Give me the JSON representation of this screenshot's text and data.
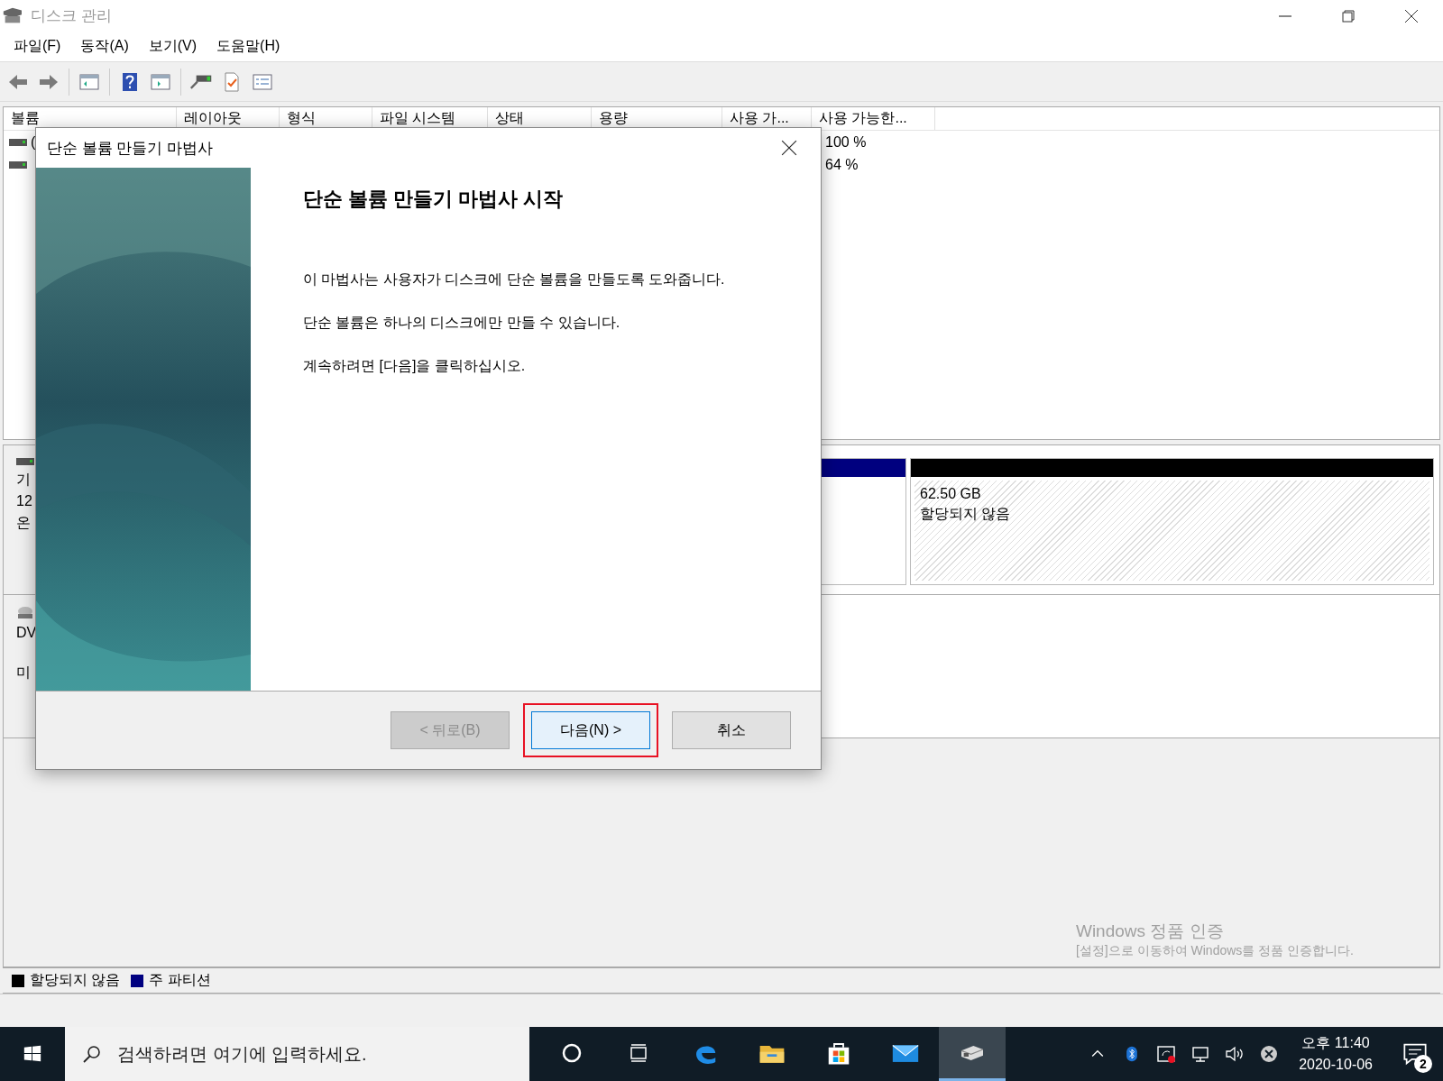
{
  "window": {
    "title": "디스크 관리"
  },
  "menu": [
    "파일(F)",
    "동작(A)",
    "보기(V)",
    "도움말(H)"
  ],
  "toolbar": [
    {
      "kind": "back"
    },
    {
      "kind": "forward"
    },
    {
      "kind": "sep"
    },
    {
      "kind": "pane"
    },
    {
      "kind": "sep"
    },
    {
      "kind": "help"
    },
    {
      "kind": "pane2"
    },
    {
      "kind": "sep"
    },
    {
      "kind": "connect"
    },
    {
      "kind": "check"
    },
    {
      "kind": "props"
    }
  ],
  "volume_table": {
    "columns": [
      "볼륨",
      "레이아웃",
      "형식",
      "파일 시스템",
      "상태",
      "용량",
      "사용 가...",
      "사용 가능한..."
    ],
    "rows": [
      {
        "volume": "(",
        "column_8": "100 %"
      },
      {
        "column_8": "64 %"
      }
    ]
  },
  "disks": [
    {
      "kind": "disk",
      "labels": [
        "기",
        "12",
        "온"
      ],
      "partitions": [
        {
          "kind": "primary",
          "color": "#00007f"
        },
        {
          "kind": "unallocated",
          "color": "#000000",
          "size": "62.50 GB",
          "status": "할당되지 않음"
        }
      ]
    },
    {
      "kind": "dvd",
      "labels": [
        "DV",
        "미"
      ]
    }
  ],
  "activation": {
    "title": "Windows 정품 인증",
    "text": "[설정]으로 이동하여 Windows를 정품 인증합니다."
  },
  "legend": [
    {
      "label": "할당되지 않음",
      "color": "#000000"
    },
    {
      "label": "주 파티션",
      "color": "#000080"
    }
  ],
  "dialog": {
    "title": "단순 볼륨 만들기 마법사",
    "heading": "단순 볼륨 만들기 마법사 시작",
    "paragraphs": [
      "이 마법사는 사용자가 디스크에 단순 볼륨을 만들도록 도와줍니다.",
      "단순 볼륨은 하나의 디스크에만 만들 수 있습니다.",
      "계속하려면 [다음]을 클릭하십시오."
    ],
    "buttons": [
      {
        "label": "< 뒤로(B)",
        "disabled": true,
        "highlighted": false
      },
      {
        "label": "다음(N) >",
        "disabled": false,
        "highlighted": true
      },
      {
        "label": "취소",
        "disabled": false,
        "highlighted": false
      }
    ]
  },
  "taskbar": {
    "search_placeholder": "검색하려면 여기에 입력하세요.",
    "apps": [
      {
        "kind": "cortana",
        "active": false
      },
      {
        "kind": "taskview",
        "active": false
      },
      {
        "kind": "edge",
        "active": false
      },
      {
        "kind": "explorer",
        "active": false
      },
      {
        "kind": "store",
        "active": false
      },
      {
        "kind": "mail",
        "active": false
      },
      {
        "kind": "diskmgmt",
        "active": true
      }
    ],
    "tray": [
      {
        "kind": "chevron"
      },
      {
        "kind": "bluetooth"
      },
      {
        "kind": "sync"
      },
      {
        "kind": "network"
      },
      {
        "kind": "volume"
      },
      {
        "kind": "error"
      }
    ],
    "time": "오후 11:40",
    "date": "2020-10-06",
    "notification_count": "2"
  }
}
